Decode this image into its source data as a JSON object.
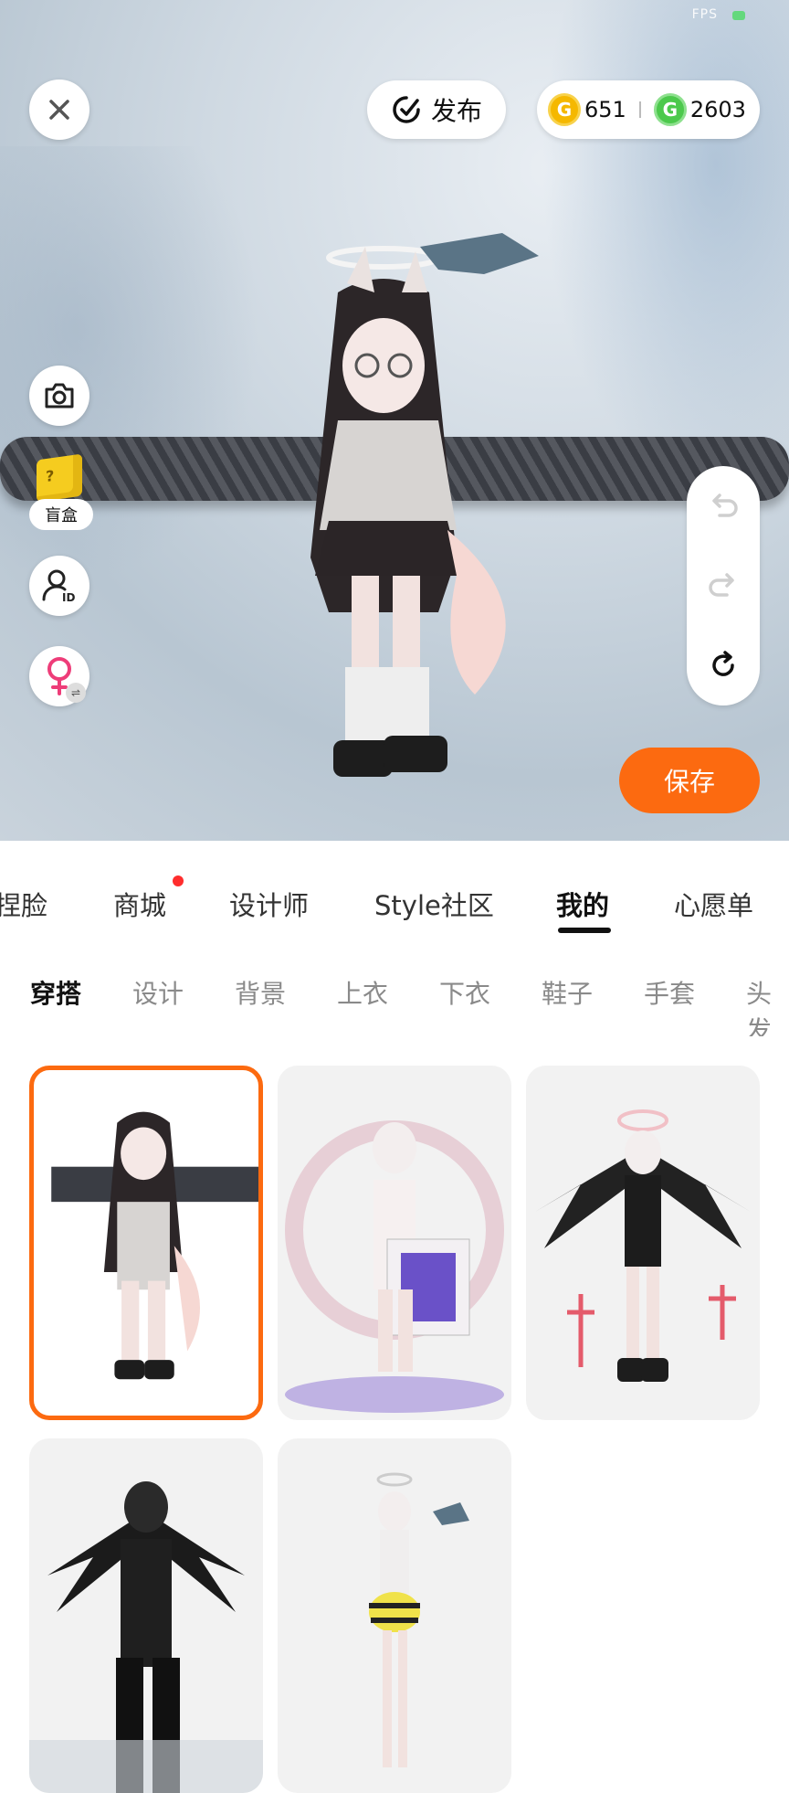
{
  "top_bar": {
    "fps_label": "FPS",
    "publish_label": "发布",
    "gold_coins": "651",
    "green_coins": "2603"
  },
  "left_tools": {
    "blind_box_label": "盲盒"
  },
  "actions": {
    "save_label": "保存"
  },
  "primary_tabs": [
    {
      "label": "捏脸",
      "active": false
    },
    {
      "label": "商城",
      "active": false,
      "badge": true
    },
    {
      "label": "设计师",
      "active": false
    },
    {
      "label": "Style社区",
      "active": false
    },
    {
      "label": "我的",
      "active": true
    },
    {
      "label": "心愿单",
      "active": false
    }
  ],
  "secondary_tabs": [
    {
      "label": "穿搭",
      "active": true
    },
    {
      "label": "设计",
      "active": false
    },
    {
      "label": "背景",
      "active": false
    },
    {
      "label": "上衣",
      "active": false
    },
    {
      "label": "下衣",
      "active": false
    },
    {
      "label": "鞋子",
      "active": false
    },
    {
      "label": "手套",
      "active": false
    },
    {
      "label": "头发",
      "active": false
    }
  ],
  "colors": {
    "accent": "#fc6a10",
    "badge": "#ff2d2d"
  },
  "outfits": [
    {
      "selected": true
    },
    {
      "selected": false
    },
    {
      "selected": false
    },
    {
      "selected": false
    },
    {
      "selected": false
    }
  ]
}
